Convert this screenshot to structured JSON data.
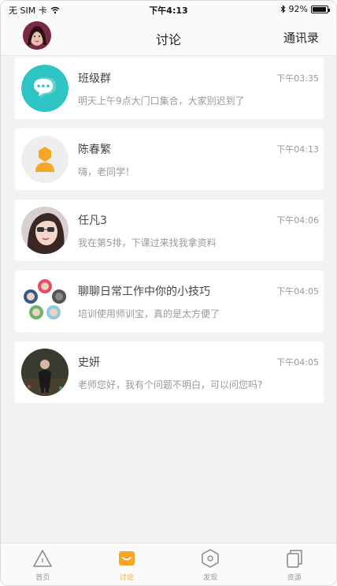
{
  "status_bar": {
    "carrier": "无 SIM 卡",
    "time": "下午4:13",
    "battery": "92%",
    "battery_level": 0.92
  },
  "header": {
    "title": "讨论",
    "right_action": "通讯录"
  },
  "conversations": [
    {
      "name": "班级群",
      "time": "下午03:35",
      "message": "明天上午9点大门口集合，大家别迟到了",
      "avatar": "chat-bubble-icon"
    },
    {
      "name": "陈春繁",
      "time": "下午04:13",
      "message": "嗨，老同学！",
      "avatar": "default-user-icon"
    },
    {
      "name": "任凡3",
      "time": "下午04:06",
      "message": "我在第5排，下课过来找我拿资料",
      "avatar": "photo-avatar"
    },
    {
      "name": "聊聊日常工作中你的小技巧",
      "time": "下午04:05",
      "message": "培训使用师训宝，真的是太方便了",
      "avatar": "group-avatar"
    },
    {
      "name": "史妍",
      "time": "下午04:05",
      "message": "老师您好，我有个问题不明白，可以问您吗?",
      "avatar": "photo-avatar"
    }
  ],
  "tabs": [
    {
      "label": "首页",
      "icon": "home-triangle-icon",
      "active": false
    },
    {
      "label": "讨论",
      "icon": "discussion-icon",
      "active": true
    },
    {
      "label": "发现",
      "icon": "discover-hexagon-icon",
      "active": false
    },
    {
      "label": "资源",
      "icon": "resources-icon",
      "active": false
    }
  ],
  "colors": {
    "accent": "#f5a623",
    "teal": "#2ec4c4",
    "background": "#f2f2f2"
  }
}
